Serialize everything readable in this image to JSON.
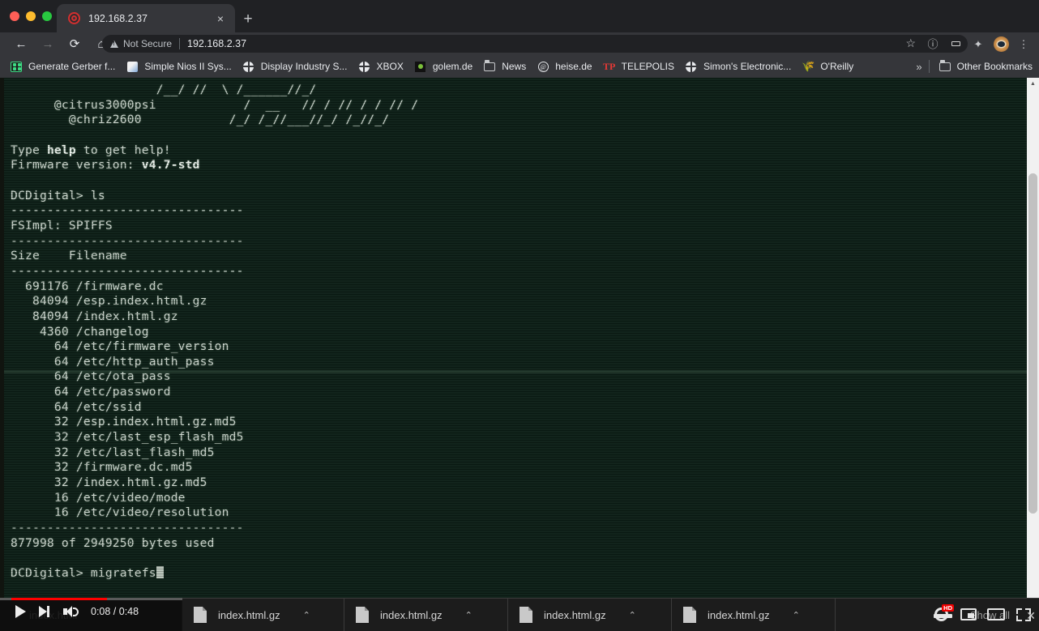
{
  "window": {
    "traffic_lights": [
      "close",
      "minimize",
      "maximize"
    ]
  },
  "tab": {
    "title": "192.168.2.37",
    "favicon": "spiral-icon",
    "close_label": "×",
    "newtab_label": "+"
  },
  "toolbar": {
    "back": "←",
    "forward": "→",
    "reload": "⟳",
    "home": "⌂",
    "security_label": "Not Secure",
    "url": "192.168.2.37",
    "star": "☆",
    "info": "ⓘ",
    "reading_list": "reading-list-icon",
    "extensions": "✦",
    "profile": "profile-avatar",
    "menu": "⋮"
  },
  "bookmarks": {
    "items": [
      {
        "label": "Generate Gerber f...",
        "icon": "gerber-icon"
      },
      {
        "label": "Simple Nios II Sys...",
        "icon": "nios-icon"
      },
      {
        "label": "Display Industry S...",
        "icon": "globe-icon"
      },
      {
        "label": "XBOX",
        "icon": "globe-icon"
      },
      {
        "label": "golem.de",
        "icon": "golem-icon"
      },
      {
        "label": "News",
        "icon": "folder-icon"
      },
      {
        "label": "heise.de",
        "icon": "heise-icon"
      },
      {
        "label": "TELEPOLIS",
        "icon": "telepolis-icon"
      },
      {
        "label": "Simon's Electronic...",
        "icon": "globe-icon"
      },
      {
        "label": "O'Reilly",
        "icon": "oreilly-icon"
      }
    ],
    "overflow_label": "»",
    "other_bookmarks_label": "Other Bookmarks",
    "other_bookmarks_icon": "folder-icon"
  },
  "terminal": {
    "ascii_art": [
      "                    /__/ //  \\ /______//_/",
      "                  /  __   // / // / / // /",
      "                  /_/ /_//___//_/ /_//_/"
    ],
    "handles": [
      "@citrus3000psi",
      "@chriz2600"
    ],
    "help_line_pre": "Type ",
    "help_line_bold": "help",
    "help_line_post": " to get help!",
    "firmware_label": "Firmware version: ",
    "firmware_value": "v4.7-std",
    "prompt": "DCDigital> ",
    "command_executed": "ls",
    "divider": "--------------------------------",
    "fsimpl_label": "FSImpl: SPIFFS",
    "columns": {
      "size": "Size",
      "filename": "Filename"
    },
    "files": [
      {
        "size": "691176",
        "name": "/firmware.dc"
      },
      {
        "size": "84094",
        "name": "/esp.index.html.gz"
      },
      {
        "size": "84094",
        "name": "/index.html.gz"
      },
      {
        "size": "4360",
        "name": "/changelog"
      },
      {
        "size": "64",
        "name": "/etc/firmware_version"
      },
      {
        "size": "64",
        "name": "/etc/http_auth_pass"
      },
      {
        "size": "64",
        "name": "/etc/ota_pass"
      },
      {
        "size": "64",
        "name": "/etc/password"
      },
      {
        "size": "64",
        "name": "/etc/ssid"
      },
      {
        "size": "32",
        "name": "/esp.index.html.gz.md5"
      },
      {
        "size": "32",
        "name": "/etc/last_esp_flash_md5"
      },
      {
        "size": "32",
        "name": "/etc/last_flash_md5"
      },
      {
        "size": "32",
        "name": "/firmware.dc.md5"
      },
      {
        "size": "32",
        "name": "/index.html.gz.md5"
      },
      {
        "size": "16",
        "name": "/etc/video/mode"
      },
      {
        "size": "16",
        "name": "/etc/video/resolution"
      }
    ],
    "usage_line": "877998 of 2949250 bytes used",
    "current_prompt": "DCDigital> ",
    "current_input": "migratefs"
  },
  "downloads": {
    "items": [
      {
        "label": "index.html",
        "icon": "file-icon",
        "chevron": "⌃"
      },
      {
        "label": "index.html.gz",
        "icon": "file-icon",
        "chevron": "⌃"
      },
      {
        "label": "index.html.gz",
        "icon": "file-icon",
        "chevron": "⌃"
      },
      {
        "label": "index.html.gz",
        "icon": "file-icon",
        "chevron": "⌃"
      },
      {
        "label": "index.html.gz",
        "icon": "file-icon",
        "chevron": "⌃"
      }
    ],
    "show_all_label": "Show all",
    "close_label": "✕"
  },
  "player": {
    "time_display": "0:08 / 0:48",
    "quality_badge": "HD",
    "progress_percent": 17,
    "play_icon": "play-icon",
    "next_icon": "next-track-icon",
    "volume_icon": "volume-icon",
    "settings_icon": "gear-icon",
    "miniplayer_icon": "miniplayer-icon",
    "theater_icon": "theater-mode-icon",
    "fullscreen_icon": "fullscreen-icon"
  },
  "colors": {
    "terminal_bg": "#0d2017",
    "terminal_fg": "#cfd8d0",
    "chrome_bg": "#202124",
    "toolbar_bg": "#35363a",
    "progress_red": "#ff0000"
  }
}
